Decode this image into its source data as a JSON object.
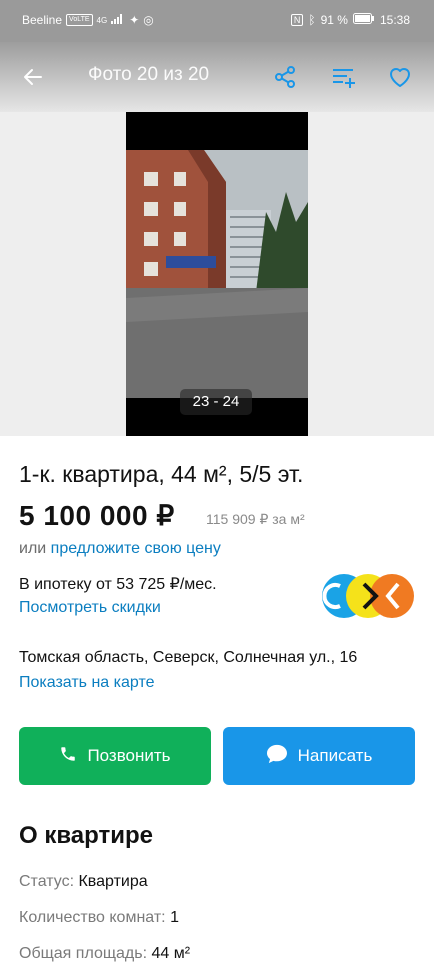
{
  "status_bar": {
    "carrier": "Beeline",
    "volte": "VoLTE",
    "network": "4G",
    "nfc": "N",
    "battery": "91 %",
    "time": "15:38"
  },
  "toolbar": {
    "title": "Фото 20 из 20",
    "back_icon": "arrow-left-icon",
    "share_icon": "share-icon",
    "compare_icon": "add-to-list-icon",
    "favorite_icon": "heart-icon"
  },
  "gallery": {
    "counter": "23 - 24"
  },
  "listing": {
    "title": "1-к. квартира, 44 м², 5/5 эт.",
    "price": "5 100 000 ₽",
    "price_per_m2": "115 909 ₽ за м²",
    "offer_prefix": "или",
    "offer_link": "предложите свою цену",
    "mortgage": "В ипотеку от 53 725 ₽/мес.",
    "discounts_link": "Посмотреть скидки",
    "address": "Томская область, Северск, Солнечная ул., 16",
    "map_link": "Показать на карте"
  },
  "actions": {
    "call_label": "Позвонить",
    "message_label": "Написать"
  },
  "about": {
    "heading": "О квартире",
    "rows": [
      {
        "key": "Статус:",
        "value": "Квартира"
      },
      {
        "key": "Количество комнат:",
        "value": "1"
      },
      {
        "key": "Общая площадь:",
        "value": "44 м²"
      }
    ]
  },
  "colors": {
    "accent_link": "#0b7ec0",
    "call_button": "#10b05a",
    "message_button": "#1996e8"
  }
}
